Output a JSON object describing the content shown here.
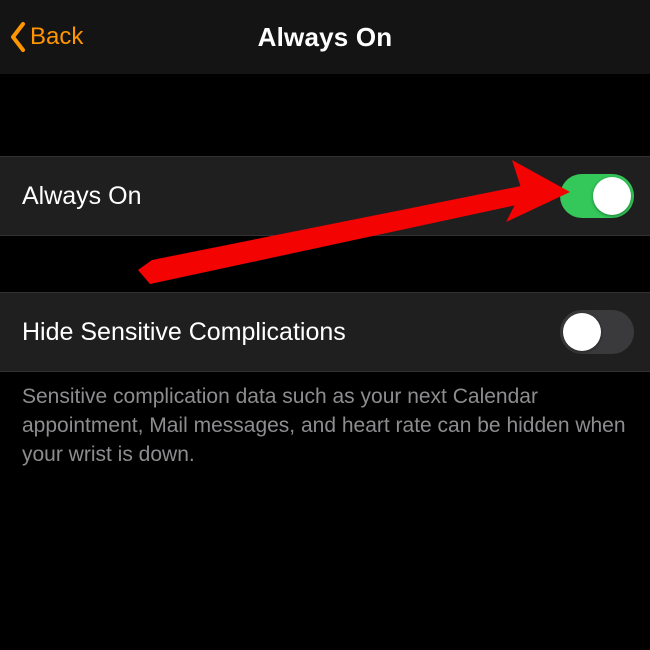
{
  "header": {
    "back_label": "Back",
    "title": "Always On"
  },
  "sections": {
    "always_on": {
      "label": "Always On",
      "enabled": true
    },
    "hide_sensitive": {
      "label": "Hide Sensitive Complications",
      "enabled": false,
      "footer": "Sensitive complication data such as your next Calendar appointment, Mail messages, and heart rate can be hidden when your wrist is down."
    }
  },
  "colors": {
    "accent": "#ff9500",
    "switch_on": "#34c759"
  }
}
